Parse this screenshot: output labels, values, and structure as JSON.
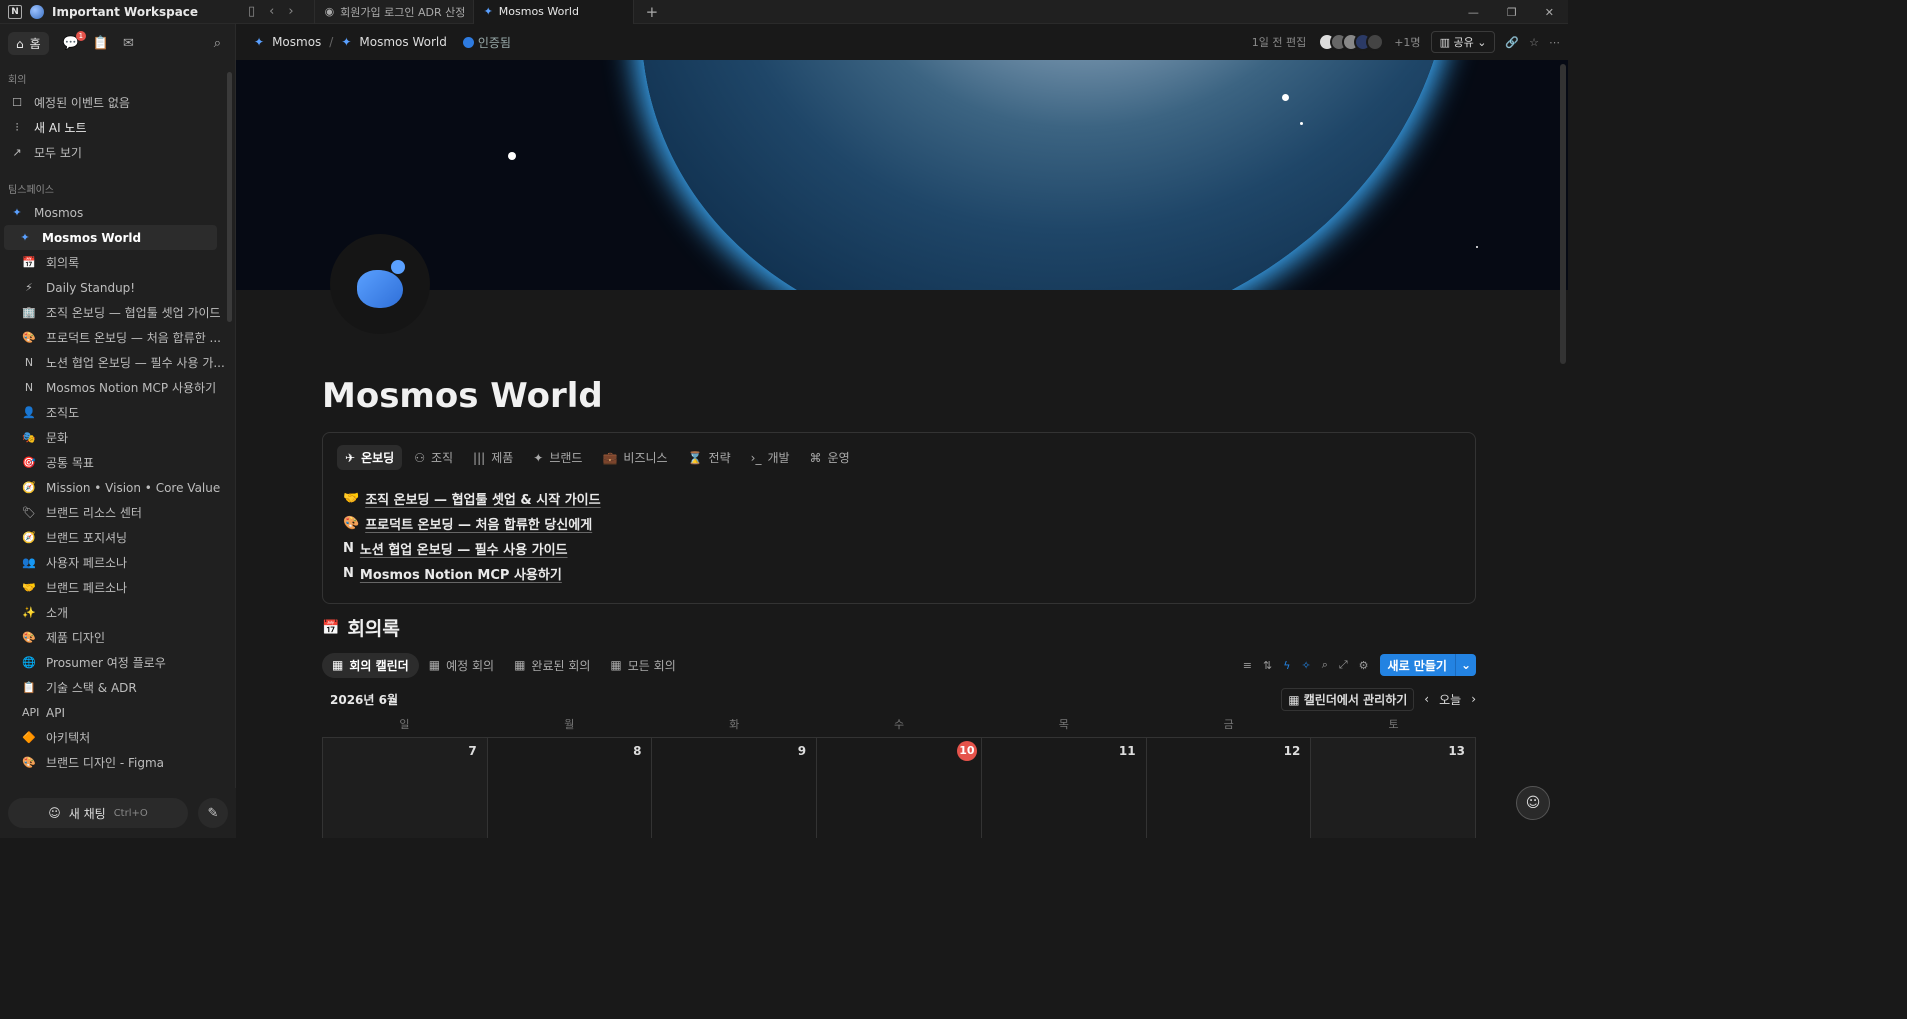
{
  "workspace": {
    "name": "Important Workspace",
    "logo": "N"
  },
  "tabs": [
    {
      "label": "회원가입 로그인 ADR 산정"
    },
    {
      "label": "Mosmos World"
    }
  ],
  "sidebar": {
    "home_label": "홈",
    "inbox_badge": "1",
    "section_meeting": "회의",
    "meeting_items": [
      {
        "icon": "☐",
        "label": "예정된 이벤트 없음"
      },
      {
        "icon": "⫶",
        "label": "새 AI 노트"
      },
      {
        "icon": "↗",
        "label": "모두 보기"
      }
    ],
    "section_team": "팀스페이스",
    "team_root": "Mosmos",
    "selected": "Mosmos World",
    "pages": [
      {
        "icon": "📅",
        "label": "회의록"
      },
      {
        "icon": "⚡",
        "label": "Daily Standup!"
      },
      {
        "icon": "🏢",
        "label": "조직 온보딩 — 협업툴 셋업 가이드"
      },
      {
        "icon": "🎨",
        "label": "프로덕트 온보딩 — 처음 합류한 ..."
      },
      {
        "icon": "N",
        "label": "노션 협업 온보딩 — 필수 사용 가..."
      },
      {
        "icon": "N",
        "label": "Mosmos Notion MCP 사용하기"
      },
      {
        "icon": "👤",
        "label": "조직도"
      },
      {
        "icon": "🎭",
        "label": "문화"
      },
      {
        "icon": "🎯",
        "label": "공통 목표"
      },
      {
        "icon": "🧭",
        "label": "Mission • Vision • Core Value"
      },
      {
        "icon": "🏷",
        "label": "브랜드 리소스 센터"
      },
      {
        "icon": "🧭",
        "label": "브랜드 포지셔닝"
      },
      {
        "icon": "👥",
        "label": "사용자 페르소나"
      },
      {
        "icon": "🤝",
        "label": "브랜드 페르소나"
      },
      {
        "icon": "✨",
        "label": "소개"
      },
      {
        "icon": "🎨",
        "label": "제품 디자인"
      },
      {
        "icon": "🌐",
        "label": "Prosumer 여정 플로우"
      },
      {
        "icon": "📋",
        "label": "기술 스택 & ADR"
      },
      {
        "icon": "API",
        "label": "API"
      },
      {
        "icon": "🔶",
        "label": "아키텍처"
      },
      {
        "icon": "🎨",
        "label": "브랜드 디자인 - Figma"
      }
    ],
    "new_chat": "새 채팅",
    "new_chat_kbd": "Ctrl+O"
  },
  "header": {
    "crumb_root": "Mosmos",
    "crumb_page": "Mosmos World",
    "verified": "인증됨",
    "edited": "1일 전 편집",
    "more_users": "+1명",
    "share": "공유"
  },
  "page": {
    "title": "Mosmos World"
  },
  "content_tabs": [
    {
      "icon": "✈",
      "label": "온보딩"
    },
    {
      "icon": "⚇",
      "label": "조직"
    },
    {
      "icon": "|||",
      "label": "제품"
    },
    {
      "icon": "✦",
      "label": "브랜드"
    },
    {
      "icon": "💼",
      "label": "비즈니스"
    },
    {
      "icon": "⌛",
      "label": "전략"
    },
    {
      "icon": "›_",
      "label": "개발"
    },
    {
      "icon": "⌘",
      "label": "운영"
    }
  ],
  "onboarding_links": [
    {
      "icon": "🤝",
      "label": "조직 온보딩 — 협업툴 셋업 & 시작 가이드"
    },
    {
      "icon": "🎨",
      "label": "프로덕트 온보딩 — 처음 합류한 당신에게"
    },
    {
      "icon": "N",
      "label": "노션 협업 온보딩 — 필수 사용 가이드"
    },
    {
      "icon": "N",
      "label": "Mosmos Notion MCP 사용하기"
    }
  ],
  "database": {
    "icon": "📅",
    "title": "회의록",
    "views": [
      {
        "label": "회의 캘린더"
      },
      {
        "label": "예정 회의"
      },
      {
        "label": "완료된 회의"
      },
      {
        "label": "모든 회의"
      }
    ],
    "new_button": "새로 만들기",
    "month": "2026년 6월",
    "manage": "캘린더에서 관리하기",
    "today": "오늘",
    "weekdays": [
      "일",
      "월",
      "화",
      "수",
      "목",
      "금",
      "토"
    ],
    "days": [
      "7",
      "8",
      "9",
      "10",
      "11",
      "12",
      "13"
    ],
    "today_day": "10"
  },
  "colors": {
    "accent": "#2383e2",
    "today": "#e5534b"
  }
}
